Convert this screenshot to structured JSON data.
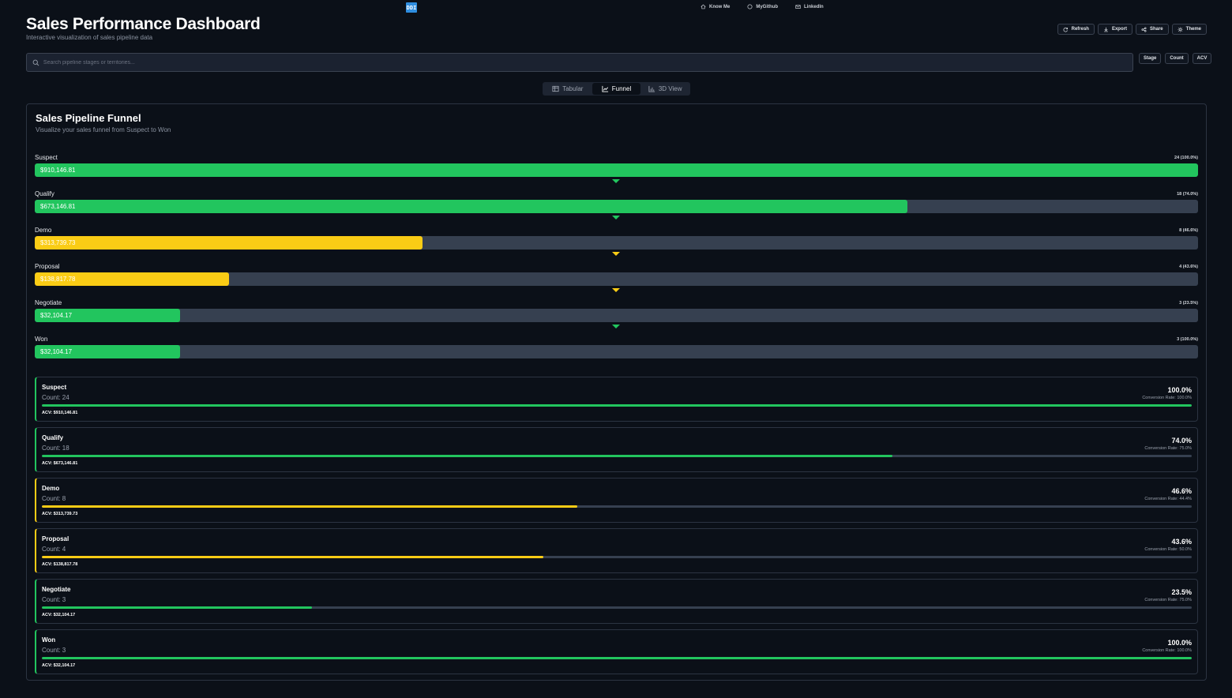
{
  "topnav": {
    "logo": "DDI",
    "links": [
      {
        "label": "Know Me",
        "icon": "home-icon"
      },
      {
        "label": "MyGithub",
        "icon": "github-icon"
      },
      {
        "label": "LinkedIn",
        "icon": "mail-icon"
      }
    ]
  },
  "header": {
    "title": "Sales Performance Dashboard",
    "subtitle": "Interactive visualization of sales pipeline data",
    "actions": [
      {
        "label": "Refresh",
        "icon": "refresh-icon"
      },
      {
        "label": "Export",
        "icon": "download-icon"
      },
      {
        "label": "Share",
        "icon": "share-icon"
      },
      {
        "label": "Theme",
        "icon": "sun-icon"
      }
    ]
  },
  "search": {
    "placeholder": "Search pipeline stages or territories...",
    "value": ""
  },
  "sort_buttons": [
    "Stage",
    "Count",
    "ACV"
  ],
  "tabs": [
    {
      "label": "Tabular",
      "icon": "table-icon",
      "active": false
    },
    {
      "label": "Funnel",
      "icon": "line-chart-icon",
      "active": true
    },
    {
      "label": "3D View",
      "icon": "bar-chart-icon",
      "active": false
    }
  ],
  "panel": {
    "title": "Sales Pipeline Funnel",
    "subtitle": "Visualize your sales funnel from Suspect to Won"
  },
  "colors": {
    "green": "#22c55e",
    "yellow": "#facc15"
  },
  "stages": [
    {
      "name": "Suspect",
      "acv": "$910,146.81",
      "count_label": "24 (100.0%)",
      "fill": 1.0,
      "color": "#22c55e",
      "arrow_color": "#22c55e"
    },
    {
      "name": "Qualify",
      "acv": "$673,146.81",
      "count_label": "18 (74.0%)",
      "fill": 0.75,
      "color": "#22c55e",
      "arrow_color": "#22c55e"
    },
    {
      "name": "Demo",
      "acv": "$313,739.73",
      "count_label": "8 (46.6%)",
      "fill": 0.333,
      "color": "#facc15",
      "arrow_color": "#facc15"
    },
    {
      "name": "Proposal",
      "acv": "$138,817.78",
      "count_label": "4 (43.6%)",
      "fill": 0.167,
      "color": "#facc15",
      "arrow_color": "#facc15"
    },
    {
      "name": "Negotiate",
      "acv": "$32,104.17",
      "count_label": "3 (23.5%)",
      "fill": 0.125,
      "color": "#22c55e",
      "arrow_color": "#22c55e"
    },
    {
      "name": "Won",
      "acv": "$32,104.17",
      "count_label": "3 (100.0%)",
      "fill": 0.125,
      "color": "#22c55e",
      "arrow_color": null
    }
  ],
  "cards": [
    {
      "name": "Suspect",
      "count": "Count: 24",
      "pct": "100.0%",
      "conversion": "Conversion Rate: 100.0%",
      "acv": "ACV: $910,146.81",
      "progress": 1.0,
      "color": "#22c55e"
    },
    {
      "name": "Qualify",
      "count": "Count: 18",
      "pct": "74.0%",
      "conversion": "Conversion Rate: 75.0%",
      "acv": "ACV: $673,146.81",
      "progress": 0.74,
      "color": "#22c55e"
    },
    {
      "name": "Demo",
      "count": "Count: 8",
      "pct": "46.6%",
      "conversion": "Conversion Rate: 44.4%",
      "acv": "ACV: $313,739.73",
      "progress": 0.466,
      "color": "#facc15"
    },
    {
      "name": "Proposal",
      "count": "Count: 4",
      "pct": "43.6%",
      "conversion": "Conversion Rate: 50.0%",
      "acv": "ACV: $138,817.78",
      "progress": 0.436,
      "color": "#facc15"
    },
    {
      "name": "Negotiate",
      "count": "Count: 3",
      "pct": "23.5%",
      "conversion": "Conversion Rate: 75.0%",
      "acv": "ACV: $32,104.17",
      "progress": 0.235,
      "color": "#22c55e"
    },
    {
      "name": "Won",
      "count": "Count: 3",
      "pct": "100.0%",
      "conversion": "Conversion Rate: 100.0%",
      "acv": "ACV: $32,104.17",
      "progress": 1.0,
      "color": "#22c55e"
    }
  ]
}
